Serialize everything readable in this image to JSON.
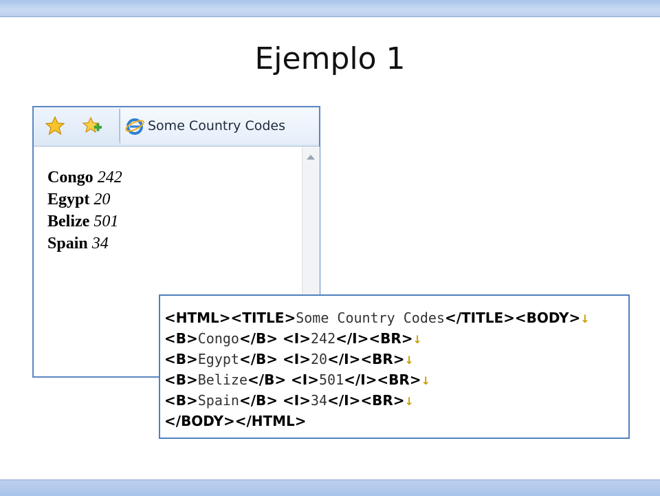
{
  "slide": {
    "title": "Ejemplo 1"
  },
  "browser": {
    "icons": {
      "favorites": "star-icon",
      "add_favorites": "add-favorite-icon",
      "page": "ie-icon"
    },
    "tab_title": "Some Country Codes",
    "rows": [
      {
        "name": "Congo",
        "code": "242"
      },
      {
        "name": "Egypt",
        "code": "20"
      },
      {
        "name": "Belize",
        "code": "501"
      },
      {
        "name": "Spain",
        "code": "34"
      }
    ]
  },
  "code_lines": [
    {
      "parts": [
        {
          "t": "tag",
          "v": "<HTML>"
        },
        {
          "t": "tag",
          "v": "<TITLE>"
        },
        {
          "t": "txt",
          "v": "Some Country Codes"
        },
        {
          "t": "tag",
          "v": "</TITLE>"
        },
        {
          "t": "tag",
          "v": "<BODY>"
        },
        {
          "t": "nl",
          "v": "↓"
        }
      ]
    },
    {
      "parts": [
        {
          "t": "tag",
          "v": "<B>"
        },
        {
          "t": "txt",
          "v": "Congo"
        },
        {
          "t": "tag",
          "v": "</B> "
        },
        {
          "t": "tag",
          "v": "<I>"
        },
        {
          "t": "txt",
          "v": "242"
        },
        {
          "t": "tag",
          "v": "</I>"
        },
        {
          "t": "tag",
          "v": "<BR>"
        },
        {
          "t": "nl",
          "v": "↓"
        }
      ]
    },
    {
      "parts": [
        {
          "t": "tag",
          "v": "<B>"
        },
        {
          "t": "txt",
          "v": "Egypt"
        },
        {
          "t": "tag",
          "v": "</B> "
        },
        {
          "t": "tag",
          "v": "<I>"
        },
        {
          "t": "txt",
          "v": "20"
        },
        {
          "t": "tag",
          "v": "</I>"
        },
        {
          "t": "tag",
          "v": "<BR>"
        },
        {
          "t": "nl",
          "v": "↓"
        }
      ]
    },
    {
      "parts": [
        {
          "t": "tag",
          "v": "<B>"
        },
        {
          "t": "txt",
          "v": "Belize"
        },
        {
          "t": "tag",
          "v": "</B> "
        },
        {
          "t": "tag",
          "v": "<I>"
        },
        {
          "t": "txt",
          "v": "501"
        },
        {
          "t": "tag",
          "v": "</I>"
        },
        {
          "t": "tag",
          "v": "<BR>"
        },
        {
          "t": "nl",
          "v": "↓"
        }
      ]
    },
    {
      "parts": [
        {
          "t": "tag",
          "v": "<B>"
        },
        {
          "t": "txt",
          "v": "Spain"
        },
        {
          "t": "tag",
          "v": "</B> "
        },
        {
          "t": "tag",
          "v": "<I>"
        },
        {
          "t": "txt",
          "v": "34"
        },
        {
          "t": "tag",
          "v": "</I>"
        },
        {
          "t": "tag",
          "v": "<BR>"
        },
        {
          "t": "nl",
          "v": "↓"
        }
      ]
    },
    {
      "parts": [
        {
          "t": "tag",
          "v": "</BODY>"
        },
        {
          "t": "tag",
          "v": "</HTML>"
        }
      ]
    }
  ]
}
